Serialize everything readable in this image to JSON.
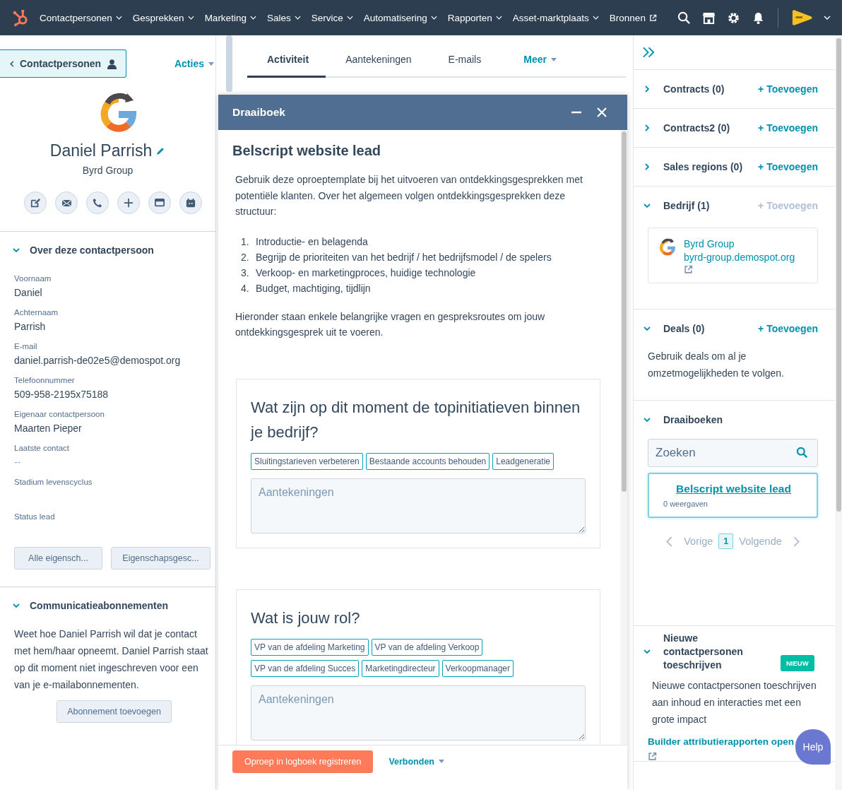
{
  "nav": {
    "items": [
      {
        "label": "Contactpersonen",
        "kind": "menu"
      },
      {
        "label": "Gesprekken",
        "kind": "menu"
      },
      {
        "label": "Marketing",
        "kind": "menu"
      },
      {
        "label": "Sales",
        "kind": "menu"
      },
      {
        "label": "Service",
        "kind": "menu"
      },
      {
        "label": "Automatisering",
        "kind": "menu"
      },
      {
        "label": "Rapporten",
        "kind": "menu"
      },
      {
        "label": "Asset-marktplaats",
        "kind": "menu"
      },
      {
        "label": "Bronnen",
        "kind": "external"
      }
    ]
  },
  "contact": {
    "back_button": "Contactpersonen",
    "actions": "Acties",
    "name": "Daniel Parrish",
    "company": "Byrd Group",
    "about": {
      "title": "Over deze contactpersoon",
      "expanded": true,
      "fields": [
        {
          "label": "Voornaam",
          "value": "Daniel"
        },
        {
          "label": "Achternaam",
          "value": "Parrish"
        },
        {
          "label": "E-mail",
          "value": "daniel.parrish-de02e5@demospot.org"
        },
        {
          "label": "Telefoonnummer",
          "value": "509-958-2195x75188"
        },
        {
          "label": "Eigenaar contactpersoon",
          "value": "Maarten Pieper"
        },
        {
          "label": "Laatste contact",
          "value": "--"
        },
        {
          "label": "Stadium levenscyclus"
        },
        {
          "label": "Status lead"
        }
      ],
      "buttons": [
        "Alle eigensch...",
        "Eigenschapsgesc..."
      ]
    },
    "subscriptions": {
      "title": "Communicatieabonnementen",
      "expanded": true,
      "text": "Weet hoe Daniel Parrish wil dat je contact met hem/haar opneemt. Daniel Parrish staat op dit moment niet ingeschreven voor een van je e-mailabonnementen.",
      "button": "Abonnement toevoegen"
    }
  },
  "tabs": [
    {
      "label": "Activiteit",
      "selected": true,
      "kind": "tab"
    },
    {
      "label": "Aantekeningen",
      "selected": false,
      "kind": "tab"
    },
    {
      "label": "E-mails",
      "selected": false,
      "kind": "tab"
    },
    {
      "label": "Meer",
      "selected": false,
      "kind": "dropdown"
    }
  ],
  "playbook": {
    "title": "Draaiboek",
    "heading": "Belscript website lead",
    "intro": "Gebruik deze oproeptemplate bij het uitvoeren van ontdekkingsgesprekken met potentiële klanten. Over het algemeen volgen ontdekkingsgesprekken deze structuur:",
    "steps": [
      {
        "number": "1.",
        "text": "Introductie- en belagenda"
      },
      {
        "number": "2.",
        "text": "Begrijp de prioriteiten van het bedrijf / het bedrijfsmodel / de spelers"
      },
      {
        "number": "3.",
        "text": "Verkoop- en marketingproces, huidige technologie"
      },
      {
        "number": "4.",
        "text": "Budget, machtiging, tijdlijn"
      }
    ],
    "outro": "Hieronder staan enkele belangrijke vragen en gespreksroutes om jouw ontdekkingsgesprek uit te voeren.",
    "questions": [
      {
        "question": "Wat zijn op dit moment de topinitiatieven binnen je bedrijf?",
        "tags": [
          "Sluitingstarieven verbeteren",
          "Bestaande accounts behouden",
          "Leadgeneratie"
        ],
        "placeholder": "Aantekeningen"
      },
      {
        "question": "Wat is jouw rol?",
        "tags": [
          "VP van de afdeling Marketing",
          "VP van de afdeling Verkoop",
          "VP van de afdeling Succes",
          "Marketingdirecteur",
          "Verkoopmanager"
        ],
        "placeholder": "Aantekeningen"
      }
    ],
    "log_button": "Oproep in logboek registreren",
    "status": "Verbonden"
  },
  "sidebar": {
    "sections": [
      {
        "kind": "empty",
        "title": "Contracts (0)",
        "expanded": false,
        "add": "+ Toevoegen",
        "add_disabled": false
      },
      {
        "kind": "empty",
        "title": "Contracts2 (0)",
        "expanded": false,
        "add": "+ Toevoegen",
        "add_disabled": false
      },
      {
        "kind": "empty",
        "title": "Sales regions (0)",
        "expanded": false,
        "add": "+ Toevoegen",
        "add_disabled": false
      },
      {
        "kind": "company",
        "title": "Bedrijf (1)",
        "expanded": true,
        "add": "+ Toevoegen",
        "add_disabled": true,
        "company_name": "Byrd Group",
        "domain": "byrd-group.demospot.org"
      },
      {
        "kind": "text",
        "title": "Deals (0)",
        "expanded": true,
        "add": "+ Toevoegen",
        "add_disabled": false,
        "text": "Gebruik deals om al je omzetmogelijkheden te volgen."
      },
      {
        "kind": "playbooks",
        "title": "Draaiboeken",
        "expanded": true,
        "placeholder": "Zoeken",
        "result": "Belscript website lead",
        "views": "0 weergaven",
        "prev": "Vorige",
        "page": "1",
        "next": "Volgende"
      },
      {
        "kind": "attribution",
        "title": "Nieuwe contactpersonen toeschrijven",
        "expanded": true,
        "badge": "NIEUW",
        "text": "Nieuwe contactpersonen toeschrijven aan inhoud en interacties met een grote impact",
        "link": "Builder attributierapporten open"
      }
    ]
  },
  "help": "Help"
}
